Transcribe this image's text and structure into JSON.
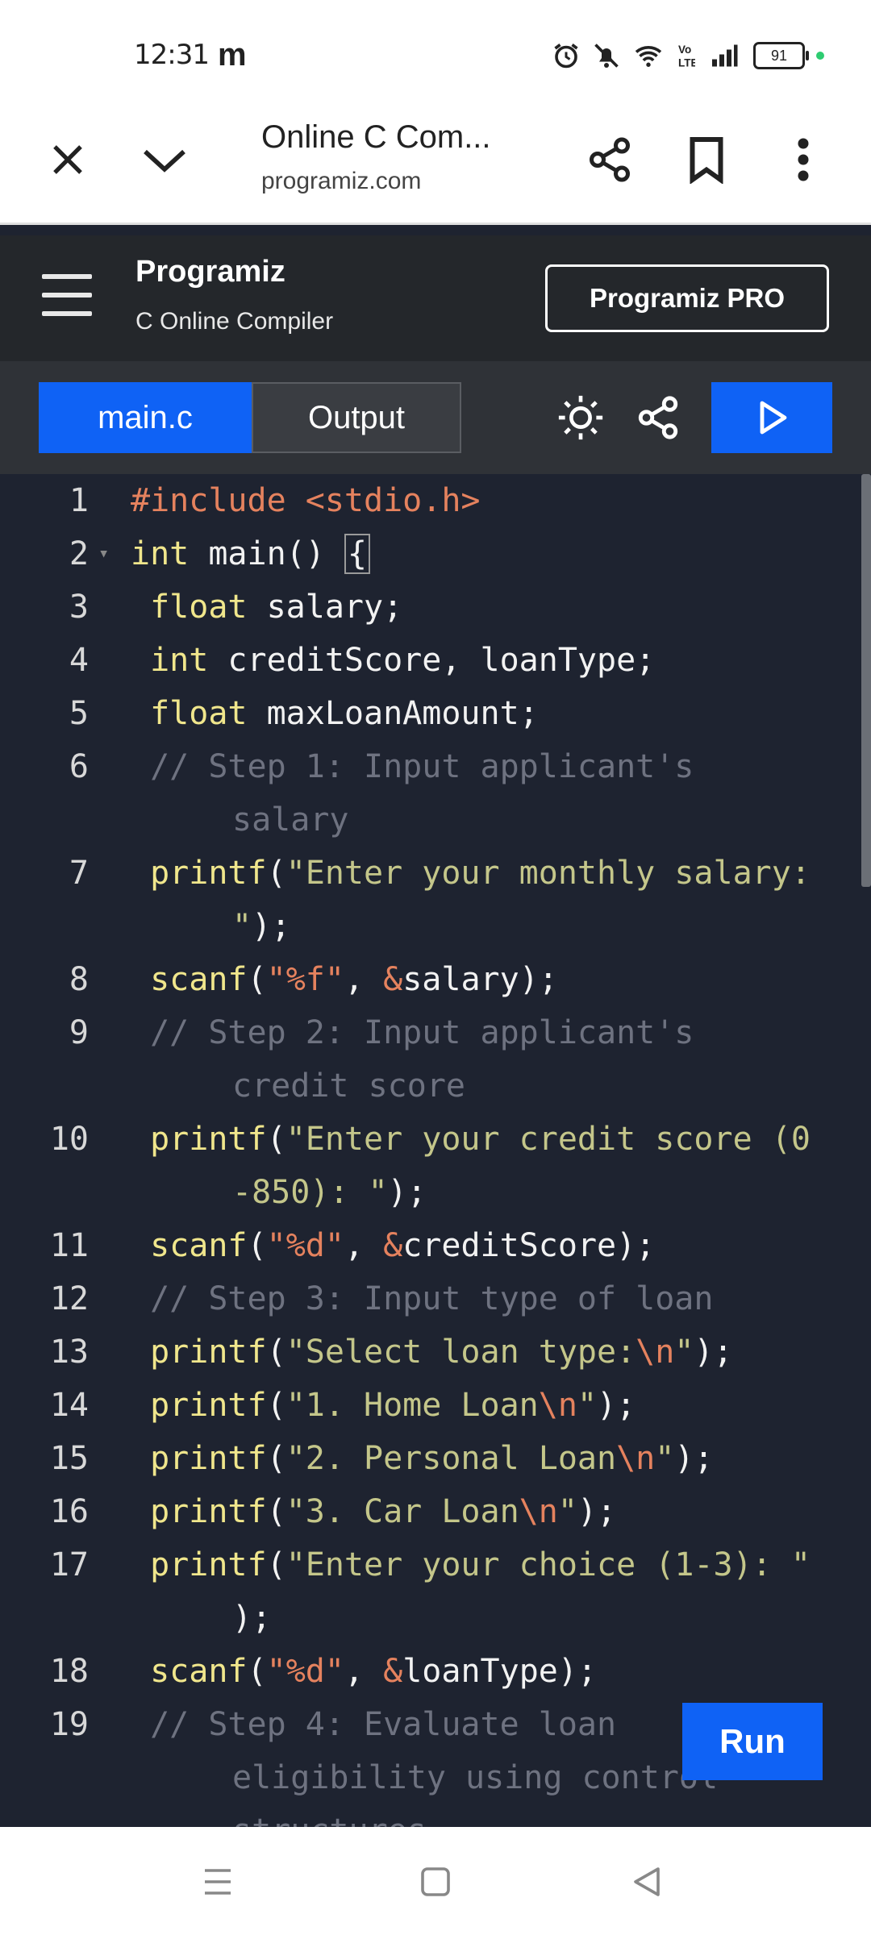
{
  "status_bar": {
    "time": "12:31",
    "app_letter": "m",
    "battery": "91"
  },
  "browser": {
    "title": "Online C Com...",
    "url": "programiz.com"
  },
  "site_header": {
    "logo": "Programiz",
    "subtitle": "C Online Compiler",
    "pro_button": "Programiz PRO"
  },
  "toolbar": {
    "tabs": [
      {
        "label": "main.c",
        "active": true
      },
      {
        "label": "Output",
        "active": false
      }
    ],
    "icons": [
      "theme-sun-icon",
      "share-icon",
      "play-icon"
    ]
  },
  "editor": {
    "line_numbers": [
      "1",
      "2",
      "3",
      "4",
      "5",
      "6",
      "7",
      "8",
      "9",
      "10",
      "11",
      "12",
      "13",
      "14",
      "15",
      "16",
      "17",
      "18",
      "19"
    ],
    "lines": [
      {
        "n": "1",
        "parts": [
          "#include ",
          "<stdio.h>"
        ]
      },
      {
        "n": "2",
        "parts": [
          "int",
          " main() ",
          "{"
        ]
      },
      {
        "n": "3",
        "parts": [
          "float",
          " salary;"
        ]
      },
      {
        "n": "4",
        "parts": [
          "int",
          " creditScore, loanType;"
        ]
      },
      {
        "n": "5",
        "parts": [
          "float",
          " maxLoanAmount;"
        ]
      },
      {
        "n": "6",
        "parts": [
          "// Step 1: Input applicant's",
          "salary"
        ]
      },
      {
        "n": "7",
        "parts": [
          "printf",
          "(",
          "\"Enter your monthly salary:",
          "\"",
          ");"
        ]
      },
      {
        "n": "8",
        "parts": [
          "scanf",
          "(",
          "\"%f\"",
          ", ",
          "&",
          "salary);"
        ]
      },
      {
        "n": "9",
        "parts": [
          "// Step 2: Input applicant's",
          "credit score"
        ]
      },
      {
        "n": "10",
        "parts": [
          "printf",
          "(",
          "\"Enter your credit score (0",
          "-850): \"",
          ");"
        ]
      },
      {
        "n": "11",
        "parts": [
          "scanf",
          "(",
          "\"%d\"",
          ", ",
          "&",
          "creditScore);"
        ]
      },
      {
        "n": "12",
        "parts": [
          "// Step 3: Input type of loan"
        ]
      },
      {
        "n": "13",
        "parts": [
          "printf",
          "(",
          "\"Select loan type:",
          "\\n",
          "\"",
          ");"
        ]
      },
      {
        "n": "14",
        "parts": [
          "printf",
          "(",
          "\"1. Home Loan",
          "\\n",
          "\"",
          ");"
        ]
      },
      {
        "n": "15",
        "parts": [
          "printf",
          "(",
          "\"2. Personal Loan",
          "\\n",
          "\"",
          ");"
        ]
      },
      {
        "n": "16",
        "parts": [
          "printf",
          "(",
          "\"3. Car Loan",
          "\\n",
          "\"",
          ");"
        ]
      },
      {
        "n": "17",
        "parts": [
          "printf",
          "(",
          "\"Enter your choice (1-3): \"",
          ")",
          ";"
        ]
      },
      {
        "n": "18",
        "parts": [
          "scanf",
          "(",
          "\"%d\"",
          ", ",
          "&",
          "loanType);"
        ]
      },
      {
        "n": "19",
        "parts": [
          "// Step 4: Evaluate loan",
          "eligibility using control",
          "structures"
        ]
      }
    ]
  },
  "run_button": "Run",
  "nav_bar": {
    "icons": [
      "recents-icon",
      "home-icon",
      "back-icon"
    ]
  },
  "colors": {
    "accent": "#0f62f5",
    "editor_bg": "#1e2330",
    "keyword": "#f0e68c",
    "string": "#c4c68a",
    "comment": "#6e7280",
    "header_include": "#e5825e"
  }
}
